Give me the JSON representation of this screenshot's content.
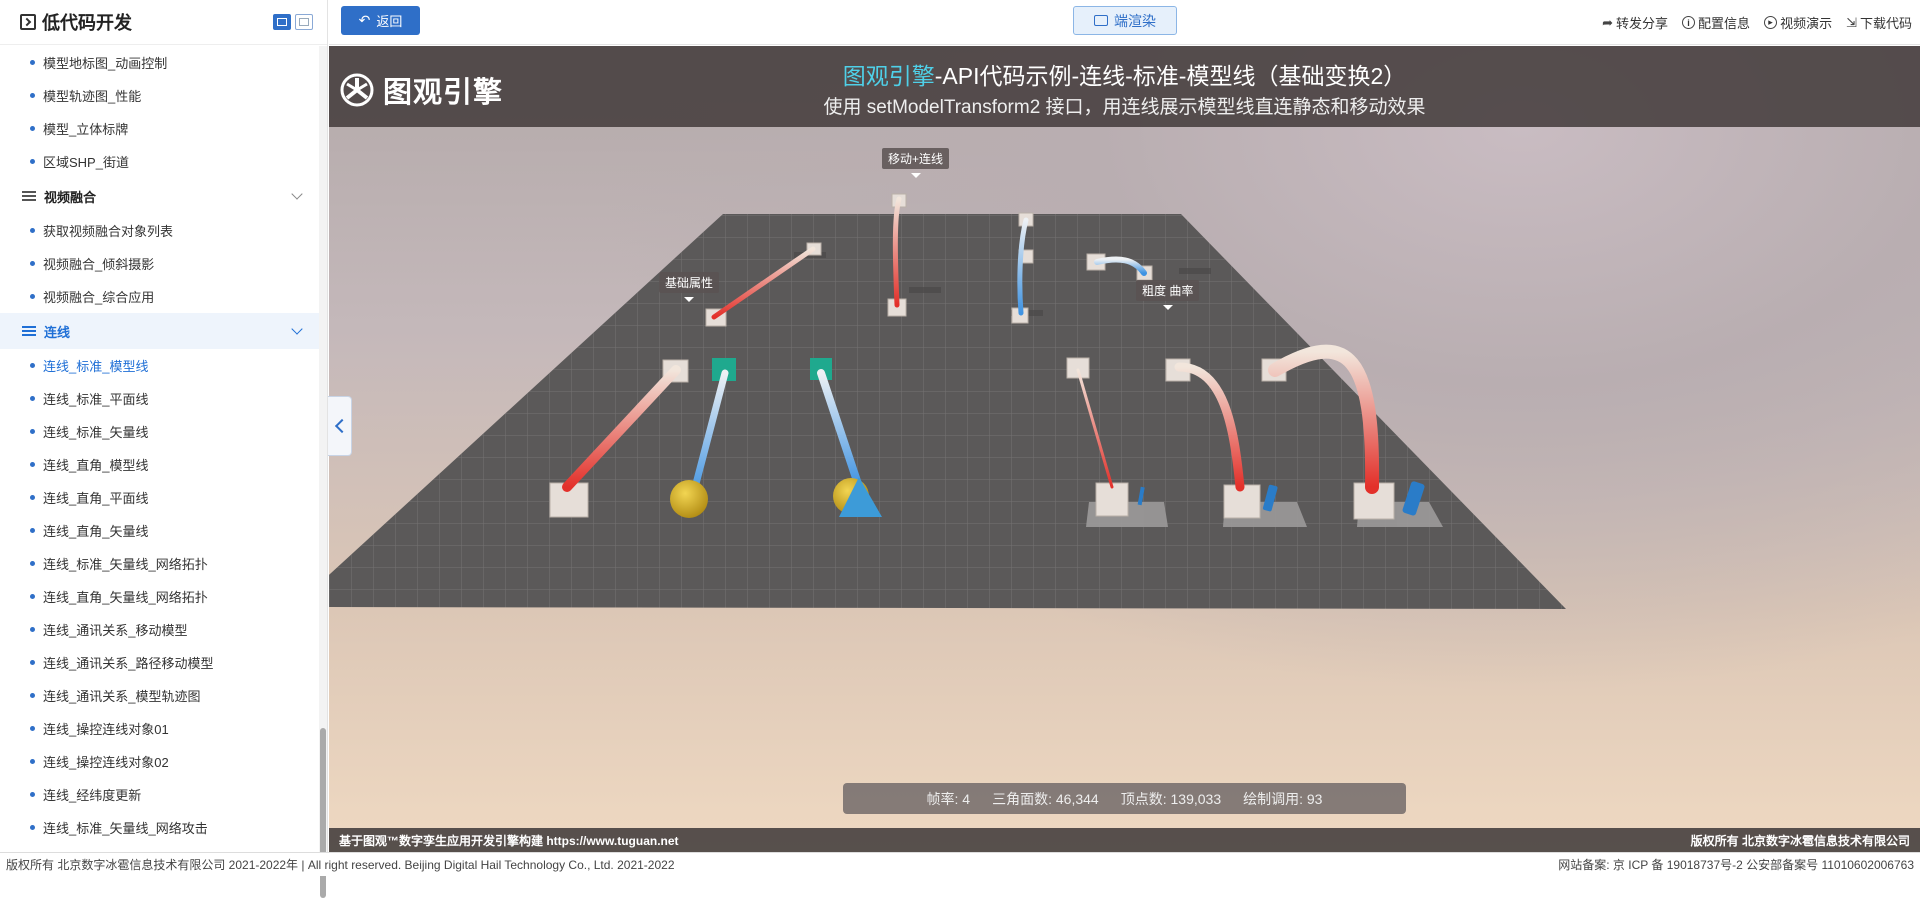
{
  "sidebar": {
    "title": "低代码开发",
    "items_top": [
      "模型地标图_动画控制",
      "模型轨迹图_性能",
      "模型_立体标牌",
      "区域SHP_街道"
    ],
    "group_video": "视频融合",
    "items_video": [
      "获取视频融合对象列表",
      "视频融合_倾斜摄影",
      "视频融合_综合应用"
    ],
    "group_line": "连线",
    "items_line": [
      "连线_标准_模型线",
      "连线_标准_平面线",
      "连线_标准_矢量线",
      "连线_直角_模型线",
      "连线_直角_平面线",
      "连线_直角_矢量线",
      "连线_标准_矢量线_网络拓扑",
      "连线_直角_矢量线_网络拓扑",
      "连线_通讯关系_移动模型",
      "连线_通讯关系_路径移动模型",
      "连线_通讯关系_模型轨迹图",
      "连线_操控连线对象01",
      "连线_操控连线对象02",
      "连线_经纬度更新",
      "连线_标准_矢量线_网络攻击"
    ]
  },
  "topbar": {
    "back_label": "返回",
    "render_label": "端渲染",
    "links": [
      "转发分享",
      "配置信息",
      "视频演示",
      "下载代码"
    ]
  },
  "viewport": {
    "brand": "图观引擎",
    "title_highlight": "图观引擎",
    "title_rest": "-API代码示例-连线-标准-模型线（基础变换2）",
    "subtitle": "使用 setModelTransform2 接口，用连线展示模型线直连静态和移动效果",
    "labels": {
      "move": "移动+连线",
      "basic": "基础属性",
      "thickness": "粗度  曲率"
    },
    "stats": {
      "fps": "帧率: 4",
      "triangles": "三角面数: 46,344",
      "vertices": "顶点数: 139,033",
      "drawcalls": "绘制调用: 93"
    },
    "footer_left": "基于图观™数字孪生应用开发引擎构建 https://www.tuguan.net",
    "footer_right": "版权所有 北京数字冰雹信息技术有限公司"
  },
  "page_footer": {
    "left": "版权所有 北京数字冰雹信息技术有限公司 2021-2022年 | All right reserved. Beijing Digital Hail Technology Co., Ltd. 2021-2022",
    "right": "网站备案: 京 ICP 备 19018737号-2 公安部备案号 11010602006763"
  },
  "colors": {
    "accent": "#2f6fc8",
    "title_highlight": "#4fd0e8",
    "line_red": "#e0312b",
    "line_blue": "#3b8fe0",
    "grid": "#5a5858"
  }
}
